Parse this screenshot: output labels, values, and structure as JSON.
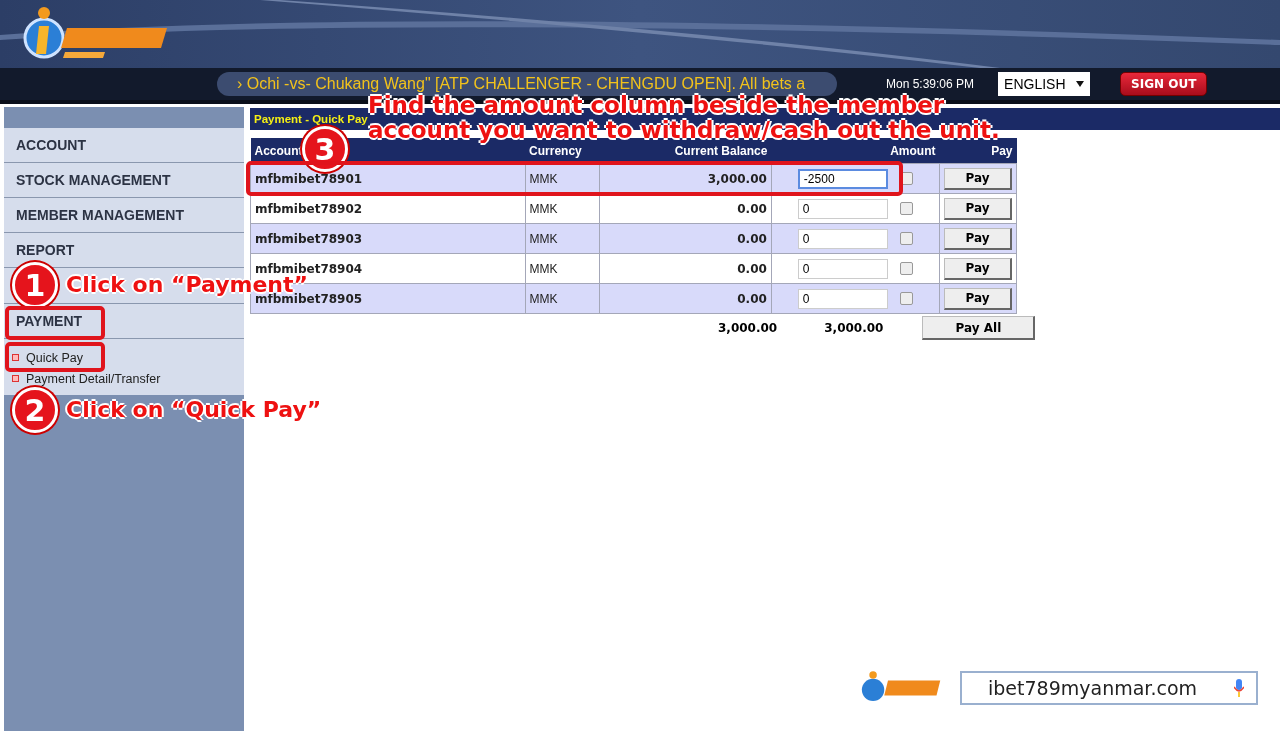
{
  "header": {
    "ticker": "› Ochi -vs- Chukang Wang\" [ATP CHALLENGER - CHENGDU OPEN]. All bets a",
    "time": "Mon 5:39:06 PM",
    "language": "ENGLISH",
    "sign_out": "SIGN OUT"
  },
  "sidebar": {
    "items": [
      {
        "label": "ACCOUNT"
      },
      {
        "label": "STOCK MANAGEMENT"
      },
      {
        "label": "MEMBER MANAGEMENT"
      },
      {
        "label": "REPORT"
      },
      {
        "label": "PAYMENT"
      }
    ],
    "subitems": [
      {
        "label": "Quick Pay"
      },
      {
        "label": "Payment Detail/Transfer"
      }
    ]
  },
  "page_title": "Payment - Quick Pay",
  "table": {
    "columns": [
      "Account",
      "Currency",
      "Current Balance",
      "Amount",
      "Pay"
    ],
    "rows": [
      {
        "account": "mfbmibet78901",
        "currency": "MMK",
        "balance": "3,000.00",
        "amount": "-2500",
        "focused": true,
        "checked": false,
        "button": "Pay"
      },
      {
        "account": "mfbmibet78902",
        "currency": "MMK",
        "balance": "0.00",
        "amount": "0",
        "focused": false,
        "checked": false,
        "button": "Pay"
      },
      {
        "account": "mfbmibet78903",
        "currency": "MMK",
        "balance": "0.00",
        "amount": "0",
        "focused": false,
        "checked": false,
        "button": "Pay"
      },
      {
        "account": "mfbmibet78904",
        "currency": "MMK",
        "balance": "0.00",
        "amount": "0",
        "focused": false,
        "checked": false,
        "button": "Pay"
      },
      {
        "account": "mfbmibet78905",
        "currency": "MMK",
        "balance": "0.00",
        "amount": "0",
        "focused": false,
        "checked": false,
        "button": "Pay"
      }
    ],
    "totals": {
      "balance": "3,000.00",
      "amount": "3,000.00",
      "button": "Pay All"
    }
  },
  "annotations": [
    {
      "number": "1",
      "text": "Click on “Payment”"
    },
    {
      "number": "2",
      "text": "Click on “Quick Pay”"
    },
    {
      "number": "3",
      "text": "Find the amount column beside the member account you want to withdraw/cash out the unit."
    }
  ],
  "url_bar": {
    "text": "ibet789myanmar.com"
  }
}
